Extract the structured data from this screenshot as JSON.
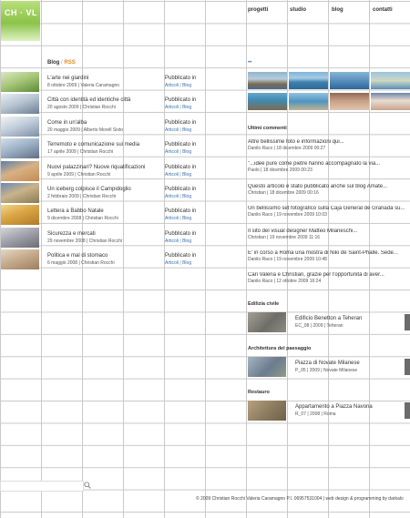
{
  "logo": {
    "text": "CH · VL"
  },
  "nav": {
    "progetti": "progetti",
    "studio": "studio",
    "blog": "blog",
    "contatti": "contatti"
  },
  "blog_header": {
    "blog": "Blog",
    "sep": " / ",
    "rss": "RSS"
  },
  "posts": [
    {
      "title": "L'arte nei giardini",
      "meta": "8 ottobre 2009 | Valeria Caramagno",
      "pub": "Pubblicato in",
      "cat1": "Articoli",
      "cat2": "Blog"
    },
    {
      "title": "Città con identità ed identiche città",
      "meta": "20 agosto 2009 | Christian Rocchi",
      "pub": "Pubblicato in",
      "cat1": "Articoli",
      "cat2": "Blog"
    },
    {
      "title": "Come in un'alba",
      "meta": "20 maggio 2009 | Alberto Morell Sixto",
      "pub": "Pubblicato in",
      "cat1": "Articoli",
      "cat2": "Blog"
    },
    {
      "title": "Terremoto e comunicazione sui media",
      "meta": "17 aprile 2009 | Christian Rocchi",
      "pub": "Pubblicato in",
      "cat1": "Articoli",
      "cat2": "Blog"
    },
    {
      "title": "Nuovi palazzinari? Nuove riqualificazioni",
      "meta": "9 aprile 2009 | Christian Rocchi",
      "pub": "Pubblicato in",
      "cat1": "Articoli",
      "cat2": "Blog"
    },
    {
      "title": "Un iceberg colpisce il Campidoglio",
      "meta": "2 febbraio 2009 | Christian Rocchi",
      "pub": "Pubblicato in",
      "cat1": "Articoli",
      "cat2": "Blog"
    },
    {
      "title": "Lettera a Babbo Natale",
      "meta": "9 dicembre 2008 | Christian Rocchi",
      "pub": "Pubblicato in",
      "cat1": "Articoli",
      "cat2": "Blog"
    },
    {
      "title": "Sicurezza e mercati",
      "meta": "29 novembre 2008 | Christian Rocchi",
      "pub": "Pubblicato in",
      "cat1": "Articoli",
      "cat2": "Blog"
    },
    {
      "title": "Politica e mal di stomaco",
      "meta": "6 maggio 2008 | Christian Rocchi",
      "pub": "Pubblicato in",
      "cat1": "Articoli",
      "cat2": "Blog"
    }
  ],
  "dots": "••",
  "comments_title": "Ultimi commenti",
  "comments": [
    {
      "text": "Altre bellissime foto e informazioni qui...",
      "meta": "Danilo Raco | 18 dicembre 2009 00:27"
    },
    {
      "text": "\"...idee pure come pietre hanno accompagnato la via...",
      "meta": "Paolo | 18 dicembre 2009 00:23"
    },
    {
      "text": "Questo articolo è stato pubblicato anche sul blog Amate...",
      "meta": "Christian | 18 dicembre 2009 00:16"
    },
    {
      "text": "Un bellissimo set fotografico sulla Caja General de Granada su...",
      "meta": "Danilo Raco | 19 novembre 2009 10:03"
    },
    {
      "text": "Il sito del visual designer Matteo Milaneschi...",
      "meta": "Christian | 19 novembre 2009 11:16"
    },
    {
      "text": "E' in corso a Roma una mostra di Niki de Saint-Phalle. Sede...",
      "meta": "Danilo Raco | 19 novembre 2009 10:48"
    },
    {
      "text": "Cari Valeria e Christian, grazie per l'opportunità di aver...",
      "meta": "Danilo Raco | 12 ottobre 2009 16:24"
    }
  ],
  "sections": [
    {
      "title": "Edilizia civile",
      "project": "Edificio Benetton a Teheran",
      "meta": "EC_08 | 2009 | Teheran"
    },
    {
      "title": "Architettura del paesaggio",
      "project": "Piazza di Novate Milanese",
      "meta": "P_05 | 2009 | Novate Milanese"
    },
    {
      "title": "Restauro",
      "project": "Appartamento a Piazza Navona",
      "meta": "R_07 | 2008 | Roma"
    }
  ],
  "footer": "© 2009 Christian Rocchi Valeria Caramagno P.I. 06957531004 | web design & programming by darkalo",
  "colors": {
    "grid": "#c9c9c9",
    "link": "#3a6fb0",
    "rss": "#e08a1e",
    "logo": "#8bc34a"
  }
}
